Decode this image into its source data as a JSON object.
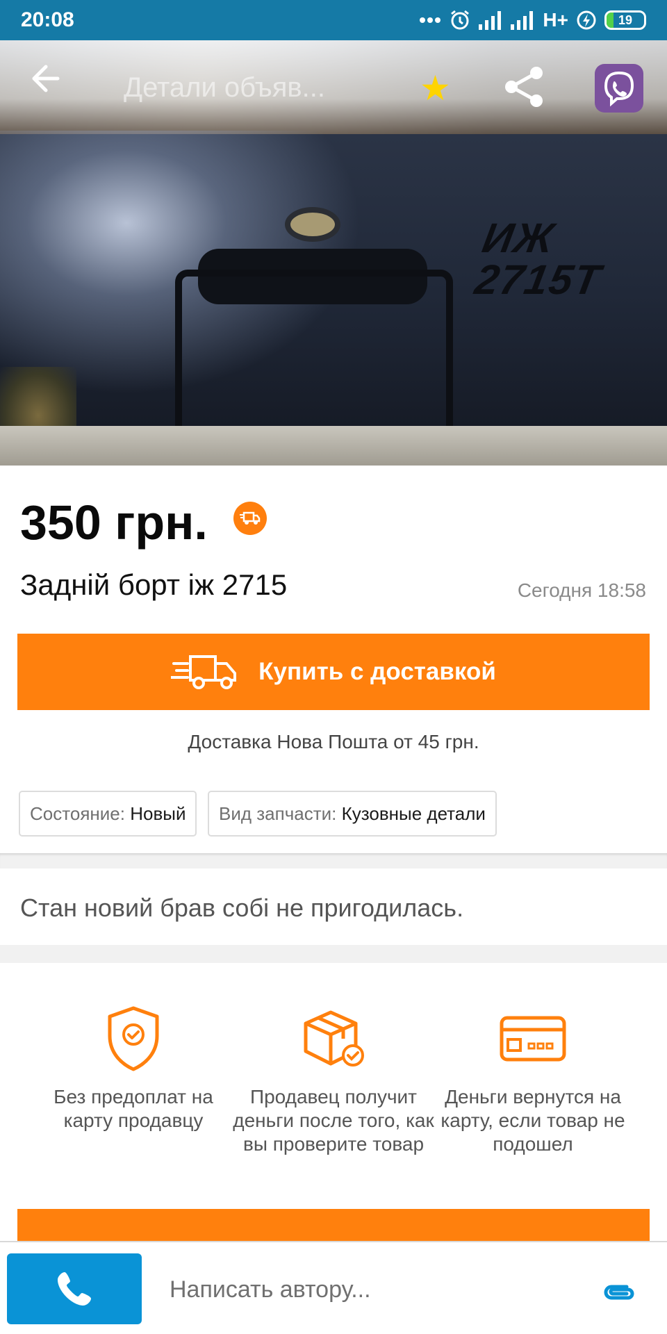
{
  "status_bar": {
    "time": "20:08",
    "network": "H+",
    "battery_level": "19",
    "icons": [
      "more-dots-icon",
      "alarm-icon",
      "signal-icon",
      "signal-icon",
      "charging-icon",
      "battery-icon"
    ]
  },
  "topbar": {
    "title": "Детали объяв...",
    "icons": [
      "back-arrow-icon",
      "star-icon",
      "share-icon",
      "viber-icon"
    ]
  },
  "gallery": {
    "embossed_text_line1": "ИЖ",
    "embossed_text_line2": "2715Т",
    "page_count": 2,
    "active_page": 1
  },
  "listing": {
    "price": "350 грн.",
    "title": "Задній борт іж 2715",
    "date": "Сегодня 18:58"
  },
  "buy_button": {
    "label": "Купить с доставкой"
  },
  "delivery_note": "Доставка Нова Пошта от 45 грн.",
  "tags": [
    {
      "key": "Состояние:",
      "value": "Новый"
    },
    {
      "key": "Вид запчасти:",
      "value": "Кузовные детали"
    }
  ],
  "description": "Стан новий брав собі не пригодилась.",
  "features": [
    {
      "icon": "shield-check-icon",
      "text": "Без предоплат на карту продавцу"
    },
    {
      "icon": "box-check-icon",
      "text": "Продавец получит деньги после того, как вы проверите товар"
    },
    {
      "icon": "card-icon",
      "text": "Деньги вернутся на карту, если товар не подошел"
    }
  ],
  "bottom_bar": {
    "message_placeholder": "Написать автору..."
  },
  "colors": {
    "status_bar": "#157aa6",
    "accent_orange": "#ff800d",
    "call_blue": "#0a93d6",
    "viber_purple": "#7b519d",
    "star_yellow": "#ffd400"
  }
}
